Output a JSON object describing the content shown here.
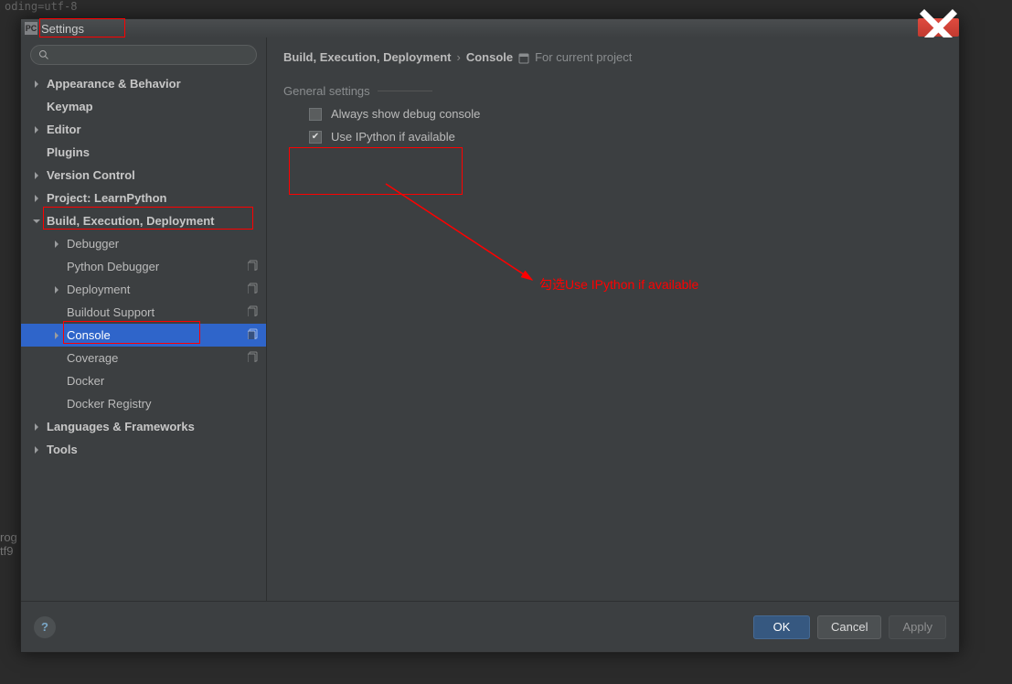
{
  "background": {
    "top_line": "oding=utf-8",
    "bottom_line1": "rog",
    "bottom_line2": "tf9"
  },
  "dialog": {
    "title": "Settings",
    "pc_label": "PC"
  },
  "search": {
    "placeholder": ""
  },
  "tree": {
    "items": [
      {
        "label": "Appearance & Behavior",
        "level": 0,
        "bold": true,
        "arrow": "right"
      },
      {
        "label": "Keymap",
        "level": 0,
        "bold": true
      },
      {
        "label": "Editor",
        "level": 0,
        "bold": true,
        "arrow": "right"
      },
      {
        "label": "Plugins",
        "level": 0,
        "bold": true
      },
      {
        "label": "Version Control",
        "level": 0,
        "bold": true,
        "arrow": "right"
      },
      {
        "label": "Project: LearnPython",
        "level": 0,
        "bold": true,
        "arrow": "right"
      },
      {
        "label": "Build, Execution, Deployment",
        "level": 0,
        "bold": true,
        "arrow": "down",
        "highlight": true
      },
      {
        "label": "Debugger",
        "level": 1,
        "arrow": "right"
      },
      {
        "label": "Python Debugger",
        "level": 1,
        "badge": true
      },
      {
        "label": "Deployment",
        "level": 1,
        "arrow": "right",
        "badge": true
      },
      {
        "label": "Buildout Support",
        "level": 1,
        "badge": true
      },
      {
        "label": "Console",
        "level": 1,
        "arrow": "right",
        "badge": true,
        "selected": true,
        "highlight": true
      },
      {
        "label": "Coverage",
        "level": 1,
        "badge": true
      },
      {
        "label": "Docker",
        "level": 1
      },
      {
        "label": "Docker Registry",
        "level": 1
      },
      {
        "label": "Languages & Frameworks",
        "level": 0,
        "bold": true,
        "arrow": "right"
      },
      {
        "label": "Tools",
        "level": 0,
        "bold": true,
        "arrow": "right"
      }
    ]
  },
  "breadcrumb": {
    "part1": "Build, Execution, Deployment",
    "sep": "›",
    "part2": "Console",
    "proj_text": "For current project"
  },
  "content": {
    "section_label": "General settings",
    "option1": {
      "label": "Always show debug console",
      "checked": false
    },
    "option2": {
      "label": "Use IPython if available",
      "checked": true
    }
  },
  "annotation": {
    "text": "勾选Use IPython if available"
  },
  "footer": {
    "help": "?",
    "ok": "OK",
    "cancel": "Cancel",
    "apply": "Apply"
  }
}
